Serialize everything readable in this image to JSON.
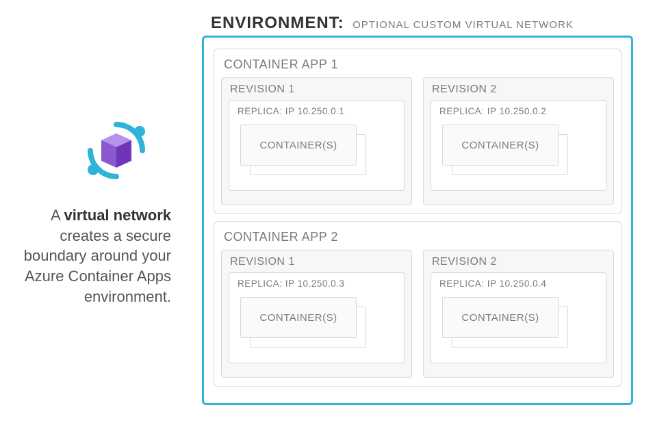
{
  "header": {
    "title": "ENVIRONMENT:",
    "subtitle": "OPTIONAL CUSTOM VIRTUAL NETWORK"
  },
  "caption": {
    "prefix": "A ",
    "strong": "virtual network",
    "rest": " creates a secure boundary around your Azure Container Apps environment."
  },
  "apps": [
    {
      "label": "CONTAINER APP 1",
      "revisions": [
        {
          "label": "REVISION 1",
          "replica": "REPLICA: IP 10.250.0.1",
          "container": "CONTAINER(S)"
        },
        {
          "label": "REVISION 2",
          "replica": "REPLICA: IP 10.250.0.2",
          "container": "CONTAINER(S)"
        }
      ]
    },
    {
      "label": "CONTAINER APP 2",
      "revisions": [
        {
          "label": "REVISION 1",
          "replica": "REPLICA: IP 10.250.0.3",
          "container": "CONTAINER(S)"
        },
        {
          "label": "REVISION 2",
          "replica": "REPLICA: IP 10.250.0.4",
          "container": "CONTAINER(S)"
        }
      ]
    }
  ]
}
